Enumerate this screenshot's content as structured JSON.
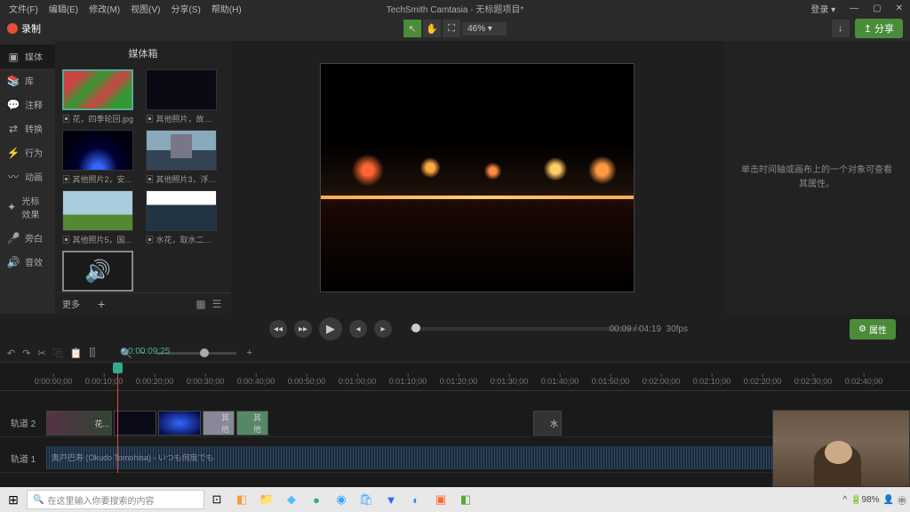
{
  "menubar": {
    "items": [
      "文件(F)",
      "编辑(E)",
      "修改(M)",
      "视图(V)",
      "分享(S)",
      "帮助(H)"
    ],
    "title": "TechSmith Camtasia - 无标题项目*",
    "login": "登录 ▾"
  },
  "toolbar": {
    "record": "录制",
    "zoom": "46%",
    "share": "分享"
  },
  "sidebar": {
    "items": [
      {
        "icon": "▣",
        "label": "媒体"
      },
      {
        "icon": "📚",
        "label": "库"
      },
      {
        "icon": "💬",
        "label": "注释"
      },
      {
        "icon": "⇄",
        "label": "转换"
      },
      {
        "icon": "⚡",
        "label": "行为"
      },
      {
        "icon": "〰",
        "label": "动画"
      },
      {
        "icon": "✦",
        "label": "光标效果"
      },
      {
        "icon": "🎤",
        "label": "旁白"
      },
      {
        "icon": "🔊",
        "label": "音效"
      }
    ]
  },
  "media": {
    "header": "媒体箱",
    "items": [
      {
        "label": "▣ 花，四季轮回.jpg"
      },
      {
        "label": "▣ 其他照片，故乡..."
      },
      {
        "label": "▣ 其他照片2，安..."
      },
      {
        "label": "▣ 其他照片3，浮光..."
      },
      {
        "label": "▣ 其他照片5，国..."
      },
      {
        "label": "▣ 水花，取水二千..."
      }
    ],
    "more": "更多",
    "add": "+"
  },
  "props": {
    "hint": "单击时间轴或画布上的一个对象可查看其属性。",
    "button": "属性"
  },
  "playback": {
    "time": "00:09 / 04:19",
    "fps": "30fps"
  },
  "timeline": {
    "playhead": "0:00:09;25",
    "ticks": [
      "0:00:00;00",
      "0:00:10;00",
      "0:00:20;00",
      "0:00:30;00",
      "0:00:40;00",
      "0:00:50;00",
      "0:01:00;00",
      "0:01:10;00",
      "0:01:20;00",
      "0:01:30;00",
      "0:01:40;00",
      "0:01:50;00",
      "0:02:00;00",
      "0:02:10;00",
      "0:02:20;00",
      "0:02:30;00",
      "0:02:40;00"
    ],
    "track2": "轨道 2",
    "track1": "轨道 1",
    "clip_huatxt": "花...",
    "clip_other1": "其他",
    "clip_other2": "其他",
    "clip_water": "水",
    "audio_title": "奥戸巴寿 (Okudo Tomohisa) - いつも何度でも"
  },
  "taskbar": {
    "search_placeholder": "在这里输入你要搜索的内容",
    "battery": "98%"
  }
}
